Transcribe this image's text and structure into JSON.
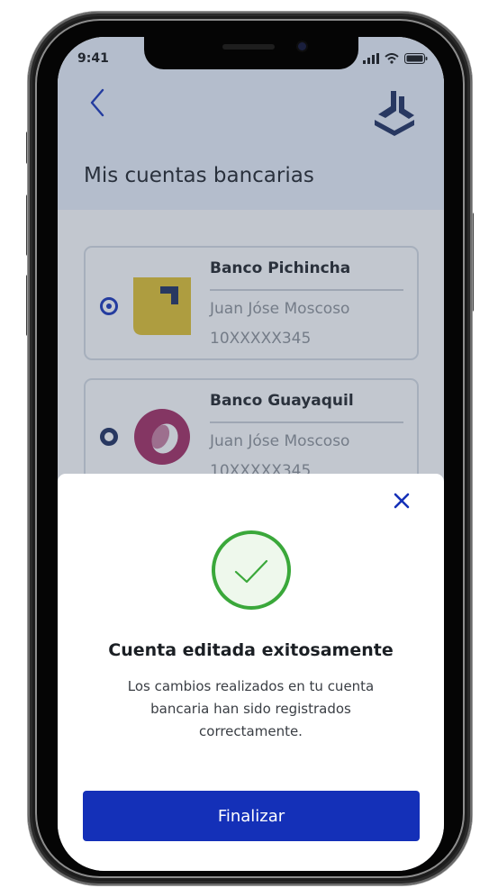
{
  "status_bar": {
    "time": "9:41"
  },
  "header": {
    "title": "Mis cuentas bancarias"
  },
  "accounts": [
    {
      "bank": "Banco Pichincha",
      "holder": "Juan Jóse Moscoso",
      "number": "10XXXXX345",
      "logo_color": "#e2c02a",
      "logo_icon": "pichincha-logo-icon"
    },
    {
      "bank": "Banco Guayaquil",
      "holder": "Juan Jóse Moscoso",
      "number": "10XXXXX345",
      "logo_color": "#a3275f",
      "logo_icon": "guayaquil-logo-icon"
    }
  ],
  "modal": {
    "title": "Cuenta editada exitosamente",
    "description": "Los cambios realizados en tu cuenta bancaria han sido registrados correctamente.",
    "button_label": "Finalizar"
  },
  "colors": {
    "primary": "#1430b8",
    "success": "#3aa83a",
    "success_bg": "#eef8ec",
    "brand_navy": "#1a2a5c"
  },
  "icons": {
    "back": "chevron-left-icon",
    "close": "close-icon",
    "success": "check-circle-icon",
    "logo": "app-logo-icon"
  }
}
